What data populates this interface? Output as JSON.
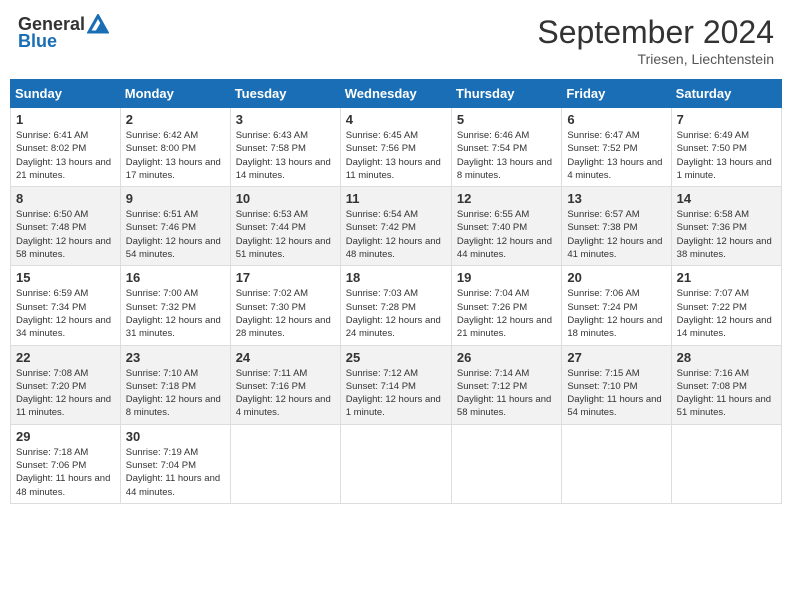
{
  "header": {
    "logo_general": "General",
    "logo_blue": "Blue",
    "month_title": "September 2024",
    "subtitle": "Triesen, Liechtenstein"
  },
  "days_of_week": [
    "Sunday",
    "Monday",
    "Tuesday",
    "Wednesday",
    "Thursday",
    "Friday",
    "Saturday"
  ],
  "weeks": [
    [
      {
        "day": "1",
        "sunrise": "Sunrise: 6:41 AM",
        "sunset": "Sunset: 8:02 PM",
        "daylight": "Daylight: 13 hours and 21 minutes."
      },
      {
        "day": "2",
        "sunrise": "Sunrise: 6:42 AM",
        "sunset": "Sunset: 8:00 PM",
        "daylight": "Daylight: 13 hours and 17 minutes."
      },
      {
        "day": "3",
        "sunrise": "Sunrise: 6:43 AM",
        "sunset": "Sunset: 7:58 PM",
        "daylight": "Daylight: 13 hours and 14 minutes."
      },
      {
        "day": "4",
        "sunrise": "Sunrise: 6:45 AM",
        "sunset": "Sunset: 7:56 PM",
        "daylight": "Daylight: 13 hours and 11 minutes."
      },
      {
        "day": "5",
        "sunrise": "Sunrise: 6:46 AM",
        "sunset": "Sunset: 7:54 PM",
        "daylight": "Daylight: 13 hours and 8 minutes."
      },
      {
        "day": "6",
        "sunrise": "Sunrise: 6:47 AM",
        "sunset": "Sunset: 7:52 PM",
        "daylight": "Daylight: 13 hours and 4 minutes."
      },
      {
        "day": "7",
        "sunrise": "Sunrise: 6:49 AM",
        "sunset": "Sunset: 7:50 PM",
        "daylight": "Daylight: 13 hours and 1 minute."
      }
    ],
    [
      {
        "day": "8",
        "sunrise": "Sunrise: 6:50 AM",
        "sunset": "Sunset: 7:48 PM",
        "daylight": "Daylight: 12 hours and 58 minutes."
      },
      {
        "day": "9",
        "sunrise": "Sunrise: 6:51 AM",
        "sunset": "Sunset: 7:46 PM",
        "daylight": "Daylight: 12 hours and 54 minutes."
      },
      {
        "day": "10",
        "sunrise": "Sunrise: 6:53 AM",
        "sunset": "Sunset: 7:44 PM",
        "daylight": "Daylight: 12 hours and 51 minutes."
      },
      {
        "day": "11",
        "sunrise": "Sunrise: 6:54 AM",
        "sunset": "Sunset: 7:42 PM",
        "daylight": "Daylight: 12 hours and 48 minutes."
      },
      {
        "day": "12",
        "sunrise": "Sunrise: 6:55 AM",
        "sunset": "Sunset: 7:40 PM",
        "daylight": "Daylight: 12 hours and 44 minutes."
      },
      {
        "day": "13",
        "sunrise": "Sunrise: 6:57 AM",
        "sunset": "Sunset: 7:38 PM",
        "daylight": "Daylight: 12 hours and 41 minutes."
      },
      {
        "day": "14",
        "sunrise": "Sunrise: 6:58 AM",
        "sunset": "Sunset: 7:36 PM",
        "daylight": "Daylight: 12 hours and 38 minutes."
      }
    ],
    [
      {
        "day": "15",
        "sunrise": "Sunrise: 6:59 AM",
        "sunset": "Sunset: 7:34 PM",
        "daylight": "Daylight: 12 hours and 34 minutes."
      },
      {
        "day": "16",
        "sunrise": "Sunrise: 7:00 AM",
        "sunset": "Sunset: 7:32 PM",
        "daylight": "Daylight: 12 hours and 31 minutes."
      },
      {
        "day": "17",
        "sunrise": "Sunrise: 7:02 AM",
        "sunset": "Sunset: 7:30 PM",
        "daylight": "Daylight: 12 hours and 28 minutes."
      },
      {
        "day": "18",
        "sunrise": "Sunrise: 7:03 AM",
        "sunset": "Sunset: 7:28 PM",
        "daylight": "Daylight: 12 hours and 24 minutes."
      },
      {
        "day": "19",
        "sunrise": "Sunrise: 7:04 AM",
        "sunset": "Sunset: 7:26 PM",
        "daylight": "Daylight: 12 hours and 21 minutes."
      },
      {
        "day": "20",
        "sunrise": "Sunrise: 7:06 AM",
        "sunset": "Sunset: 7:24 PM",
        "daylight": "Daylight: 12 hours and 18 minutes."
      },
      {
        "day": "21",
        "sunrise": "Sunrise: 7:07 AM",
        "sunset": "Sunset: 7:22 PM",
        "daylight": "Daylight: 12 hours and 14 minutes."
      }
    ],
    [
      {
        "day": "22",
        "sunrise": "Sunrise: 7:08 AM",
        "sunset": "Sunset: 7:20 PM",
        "daylight": "Daylight: 12 hours and 11 minutes."
      },
      {
        "day": "23",
        "sunrise": "Sunrise: 7:10 AM",
        "sunset": "Sunset: 7:18 PM",
        "daylight": "Daylight: 12 hours and 8 minutes."
      },
      {
        "day": "24",
        "sunrise": "Sunrise: 7:11 AM",
        "sunset": "Sunset: 7:16 PM",
        "daylight": "Daylight: 12 hours and 4 minutes."
      },
      {
        "day": "25",
        "sunrise": "Sunrise: 7:12 AM",
        "sunset": "Sunset: 7:14 PM",
        "daylight": "Daylight: 12 hours and 1 minute."
      },
      {
        "day": "26",
        "sunrise": "Sunrise: 7:14 AM",
        "sunset": "Sunset: 7:12 PM",
        "daylight": "Daylight: 11 hours and 58 minutes."
      },
      {
        "day": "27",
        "sunrise": "Sunrise: 7:15 AM",
        "sunset": "Sunset: 7:10 PM",
        "daylight": "Daylight: 11 hours and 54 minutes."
      },
      {
        "day": "28",
        "sunrise": "Sunrise: 7:16 AM",
        "sunset": "Sunset: 7:08 PM",
        "daylight": "Daylight: 11 hours and 51 minutes."
      }
    ],
    [
      {
        "day": "29",
        "sunrise": "Sunrise: 7:18 AM",
        "sunset": "Sunset: 7:06 PM",
        "daylight": "Daylight: 11 hours and 48 minutes."
      },
      {
        "day": "30",
        "sunrise": "Sunrise: 7:19 AM",
        "sunset": "Sunset: 7:04 PM",
        "daylight": "Daylight: 11 hours and 44 minutes."
      },
      null,
      null,
      null,
      null,
      null
    ]
  ]
}
